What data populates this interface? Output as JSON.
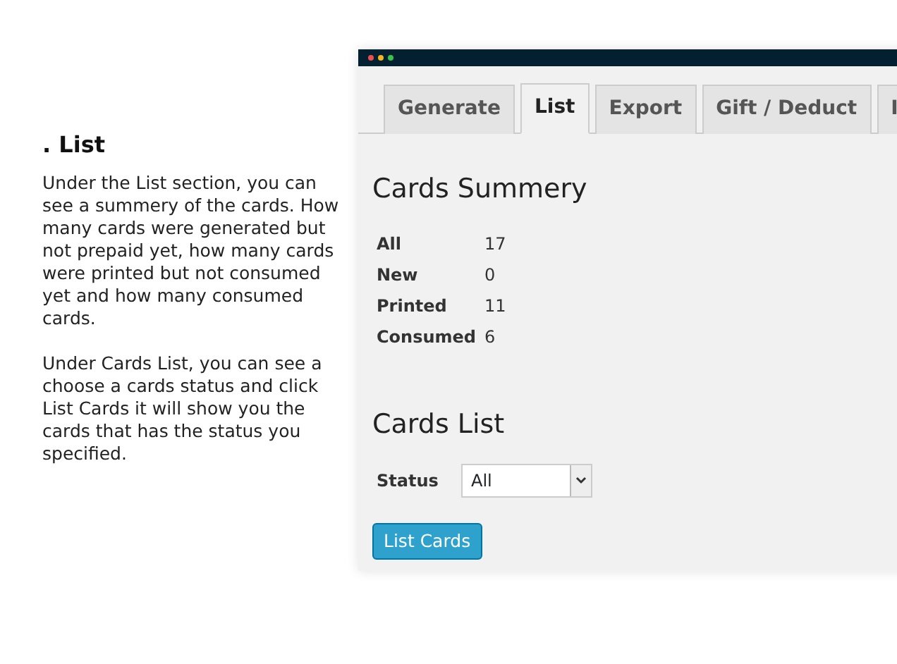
{
  "guide": {
    "heading": ". List",
    "paragraphs": [
      "Under the List section, you can see a summery of the cards. How many cards were generated but not prepaid yet, how many cards were printed but not consumed yet and how many consumed cards.",
      "Under Cards List, you can see a choose a cards status and click List Cards it will show you the cards that has the status you specified."
    ]
  },
  "window": {
    "tabs": [
      {
        "label": "Generate",
        "selected": false
      },
      {
        "label": "List",
        "selected": true
      },
      {
        "label": "Export",
        "selected": false
      },
      {
        "label": "Gift / Deduct",
        "selected": false
      },
      {
        "label": "I",
        "selected": false
      }
    ],
    "summary": {
      "title": "Cards Summery",
      "rows": [
        {
          "label": "All",
          "value": "17"
        },
        {
          "label": "New",
          "value": "0"
        },
        {
          "label": "Printed",
          "value": "11"
        },
        {
          "label": "Consumed",
          "value": "6"
        }
      ]
    },
    "cards_list": {
      "title": "Cards List",
      "status_label": "Status",
      "status_value": "All",
      "button": "List Cards"
    }
  }
}
